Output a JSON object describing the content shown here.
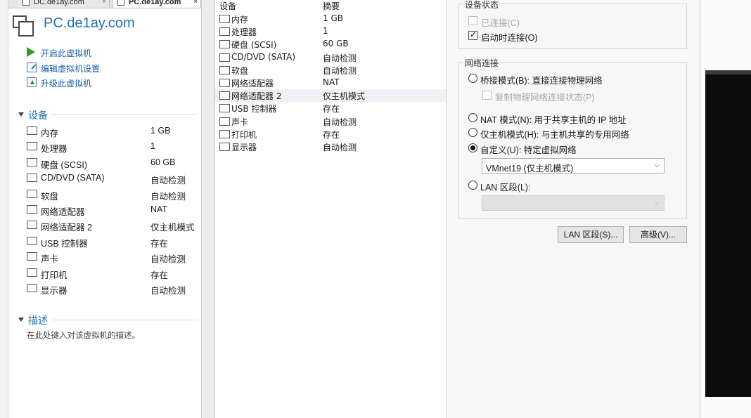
{
  "tabs": [
    {
      "label": "DC.de1ay.com",
      "close": "×"
    },
    {
      "label": "PC.de1ay.com",
      "close": "×"
    }
  ],
  "vm": {
    "title": "PC.de1ay.com",
    "actions": [
      {
        "label": "开启此虚拟机",
        "icon": "play-icon"
      },
      {
        "label": "编辑虚拟机设置",
        "icon": "edit-settings-icon"
      },
      {
        "label": "升级此虚拟机",
        "icon": "upgrade-icon"
      }
    ]
  },
  "devices_section": {
    "title": "设备",
    "items": [
      {
        "name": "内存",
        "value": "1 GB",
        "icon": "memory-icon"
      },
      {
        "name": "处理器",
        "value": "1",
        "icon": "cpu-icon"
      },
      {
        "name": "硬盘 (SCSI)",
        "value": "60 GB",
        "icon": "hard-disk-icon"
      },
      {
        "name": "CD/DVD (SATA)",
        "value": "自动检测",
        "icon": "cd-dvd-icon"
      },
      {
        "name": "软盘",
        "value": "自动检测",
        "icon": "floppy-icon"
      },
      {
        "name": "网络适配器",
        "value": "NAT",
        "icon": "network-adapter-icon"
      },
      {
        "name": "网络适配器 2",
        "value": "仅主机模式",
        "icon": "network-adapter-icon"
      },
      {
        "name": "USB 控制器",
        "value": "存在",
        "icon": "usb-icon"
      },
      {
        "name": "声卡",
        "value": "自动检测",
        "icon": "sound-card-icon"
      },
      {
        "name": "打印机",
        "value": "存在",
        "icon": "printer-icon"
      },
      {
        "name": "显示器",
        "value": "自动检测",
        "icon": "display-icon"
      }
    ]
  },
  "description_section": {
    "title": "描述",
    "placeholder": "在此处键入对该虚拟机的描述。"
  },
  "settings_list": {
    "header_device": "设备",
    "header_summary": "摘要",
    "selected_index": 6,
    "items": [
      {
        "name": "内存",
        "value": "1 GB",
        "icon": "memory-icon"
      },
      {
        "name": "处理器",
        "value": "1",
        "icon": "cpu-icon"
      },
      {
        "name": "硬盘 (SCSI)",
        "value": "60 GB",
        "icon": "hard-disk-icon"
      },
      {
        "name": "CD/DVD (SATA)",
        "value": "自动检测",
        "icon": "cd-dvd-icon"
      },
      {
        "name": "软盘",
        "value": "自动检测",
        "icon": "floppy-icon"
      },
      {
        "name": "网络适配器",
        "value": "NAT",
        "icon": "network-adapter-icon"
      },
      {
        "name": "网络适配器 2",
        "value": "仅主机模式",
        "icon": "network-adapter-icon"
      },
      {
        "name": "USB 控制器",
        "value": "存在",
        "icon": "usb-icon"
      },
      {
        "name": "声卡",
        "value": "自动检测",
        "icon": "sound-card-icon"
      },
      {
        "name": "打印机",
        "value": "存在",
        "icon": "printer-icon"
      },
      {
        "name": "显示器",
        "value": "自动检测",
        "icon": "display-icon"
      }
    ]
  },
  "device_status": {
    "title": "设备状态",
    "connected": {
      "label": "已连接(C)",
      "checked": false,
      "disabled": true
    },
    "connect_at_power_on": {
      "label": "启动时连接(O)",
      "checked": true,
      "disabled": false
    }
  },
  "network_connection": {
    "title": "网络连接",
    "bridged": {
      "label": "桥接模式(B): 直接连接物理网络",
      "selected": false
    },
    "replicate": {
      "label": "复制物理网络连接状态(P)",
      "checked": false,
      "disabled": true
    },
    "nat": {
      "label": "NAT 模式(N): 用于共享主机的 IP 地址",
      "selected": false
    },
    "host_only": {
      "label": "仅主机模式(H): 与主机共享的专用网络",
      "selected": false
    },
    "custom": {
      "label": "自定义(U): 特定虚拟网络",
      "selected": true
    },
    "custom_value": "VMnet19 (仅主机模式)",
    "lan_segment": {
      "label": "LAN 区段(L):",
      "selected": false
    },
    "lan_segment_value": ""
  },
  "buttons": {
    "lan_segments": "LAN 区段(S)...",
    "advanced": "高级(V)..."
  }
}
